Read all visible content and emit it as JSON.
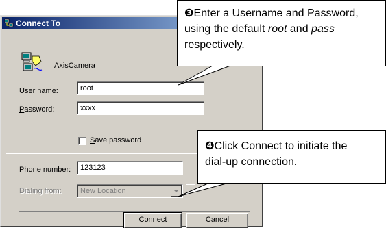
{
  "window": {
    "title": "Connect To",
    "connection_name": "AxisCamera"
  },
  "form": {
    "username_label_u": "U",
    "username_label_rest": "ser name:",
    "username_value": "root",
    "password_label_u": "P",
    "password_label_rest": "assword:",
    "password_value": "xxxx",
    "save_password_u": "S",
    "save_password_rest": "ave password",
    "save_password_checked": false,
    "phone_label_pre": "Phone ",
    "phone_label_u": "n",
    "phone_label_rest": "umber:",
    "phone_value": "123123",
    "dialing_label": "Dialing from:",
    "dialing_value": "New Location"
  },
  "buttons": {
    "connect": "Connect",
    "cancel": "Cancel"
  },
  "callouts": {
    "step3": {
      "number": "❸",
      "line1": "Enter a Username and Password,",
      "line2_pre": "using the default ",
      "line2_user": "root",
      "line2_mid": " and ",
      "line2_pass": "pass",
      "line3": "respectively."
    },
    "step4": {
      "number": "❹",
      "line1": "Click Connect to initiate the",
      "line2": "dial-up connection."
    }
  }
}
